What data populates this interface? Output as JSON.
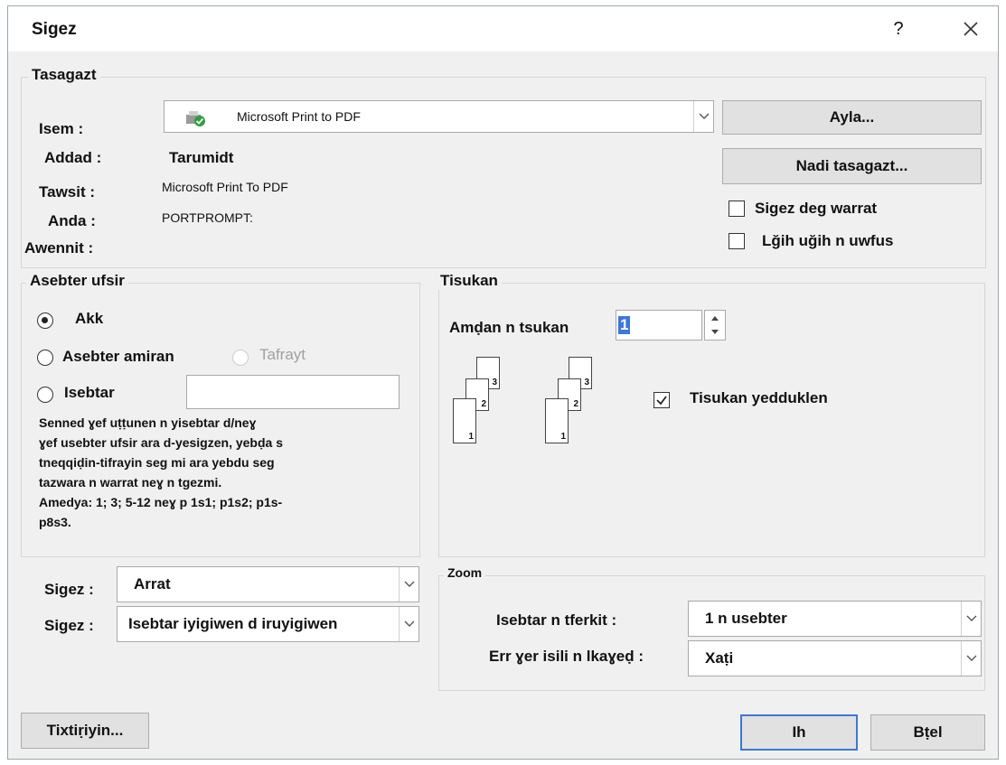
{
  "dialog": {
    "title": "Sigez",
    "help_label": "?"
  },
  "printer": {
    "section_title": "Tasagazt",
    "name_label": "Isem :",
    "name_value": "Microsoft Print to PDF",
    "status_label": "Addad :",
    "status_value": "Tarumidt",
    "type_label": "Tawsit :",
    "type_value": "Microsoft Print To PDF",
    "where_label": "Anda :",
    "where_value": "PORTPROMPT:",
    "comment_label": "Awennit :",
    "find_button": "Ayla...",
    "properties_button": "Nadi tasagazt...",
    "print_to_file_label": "Sigez deg warrat",
    "manual_duplex_label": "Lğih uğih n uwfus",
    "print_to_file_checked": false,
    "manual_duplex_checked": false
  },
  "page_range": {
    "section_title": "Asebter ufsir",
    "all_label": "Akk",
    "current_label": "Asebter amiran",
    "selection_label": "Tafrayt",
    "pages_label": "Isebtar",
    "pages_value": "",
    "selected": "all",
    "help_text": "Senned ɣef uṭṭunen n yisebtar d/neɣ\nɣef usebter ufsir ara d-yesigzen, yebḍa s\ntneqqiḍin-tifrayin seg mi ara yebdu seg\ntazwara n warrat neɣ n tgezmi.\nAmedya: 1; 3; 5-12 neɣ p 1s1; p1s2; p1s-\np8s3."
  },
  "copies": {
    "section_title": "Tisukan",
    "number_label": "Amḍan n tsukan",
    "number_value": "1",
    "collate_label": "Tisukan yedduklen",
    "collate_checked": true,
    "pages_a": [
      "1",
      "2",
      "3"
    ],
    "pages_b": [
      "1",
      "2",
      "3"
    ]
  },
  "print_options": {
    "print_what_label": "Sigez :",
    "print_what_value": "Arrat",
    "print_label": "Sigez :",
    "print_value": "Isebtar iyigiwen d iruyigiwen"
  },
  "zoom": {
    "section_title": "Zoom",
    "pages_per_sheet_label": "Isebtar n tferkit :",
    "pages_per_sheet_value": "1 n usebter",
    "scale_label": "Err ɣer isili n lkaɣeḍ :",
    "scale_value": "Xaṭi"
  },
  "footer": {
    "options_button": "Tixtiṛiyin...",
    "ok_button": "Ih",
    "cancel_button": "Bṭel"
  },
  "colors": {
    "dialog_bg": "#f0f0f0",
    "button_bg": "#e1e1e1",
    "default_button_border": "#3b78d8"
  }
}
